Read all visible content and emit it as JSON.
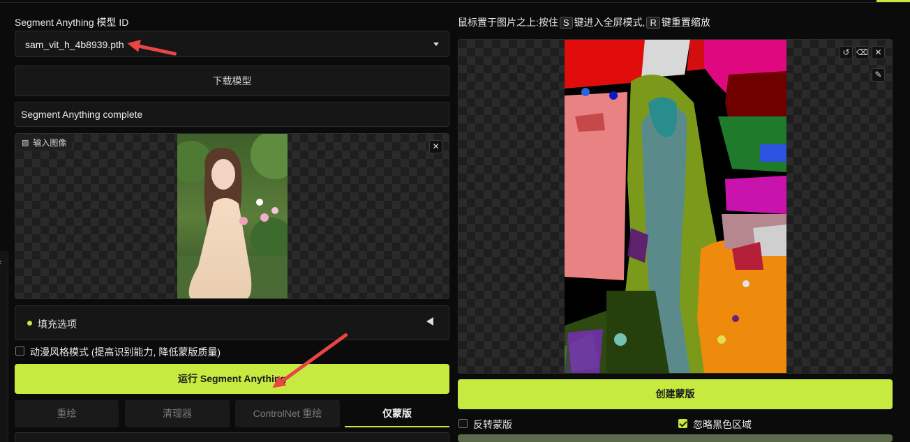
{
  "left": {
    "model_label": "Segment Anything 模型 ID",
    "model_value": "sam_vit_h_4b8939.pth",
    "download_button": "下载模型",
    "status_text": "Segment Anything complete",
    "input_image_label": "输入图像",
    "fill_options_label": "填充选项",
    "anime_mode_label": "动漫风格模式 (提高识别能力, 降低蒙版质量)",
    "run_button": "运行 Segment Anything",
    "tabs": [
      {
        "label": "重绘"
      },
      {
        "label": "清理器"
      },
      {
        "label": "ControlNet 重绘"
      },
      {
        "label": "仅蒙版"
      }
    ]
  },
  "right": {
    "hint_prefix": "鼠标置于图片之上:按住",
    "hint_key_s": "S",
    "hint_middle": "键进入全屏模式,",
    "hint_key_r": "R",
    "hint_suffix": "键重置缩放",
    "create_mask_button": "创建蒙版",
    "invert_mask_label": "反转蒙版",
    "ignore_black_label": "忽略黑色区域",
    "ignore_black_checked": true,
    "invert_checked": false
  },
  "icons": {
    "close": "close-icon",
    "undo": "undo-icon",
    "eraser": "eraser-icon",
    "brush": "brush-icon",
    "image": "image-icon",
    "collapse": "triangle-left-icon"
  },
  "colors": {
    "accent": "#c6ea40",
    "annotation_arrow": "#e84545"
  }
}
